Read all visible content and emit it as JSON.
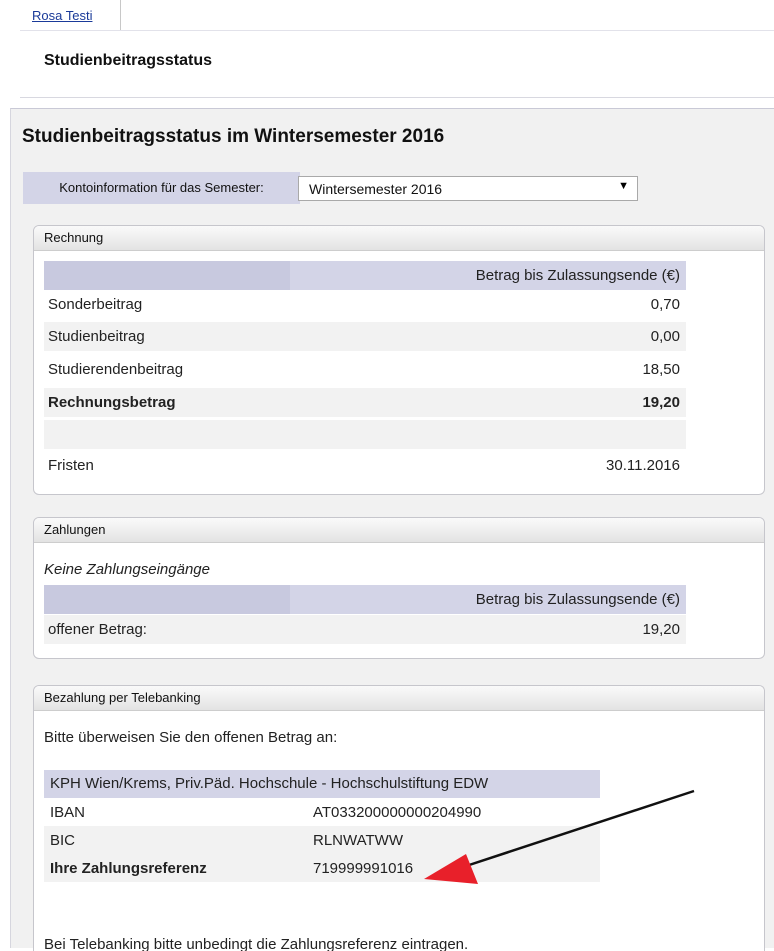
{
  "header": {
    "user_name": "Rosa Testi",
    "page_title": "Studienbeitragsstatus"
  },
  "main": {
    "title": "Studienbeitragsstatus im Wintersemester 2016",
    "semester_label": "Kontoinformation für das Semester:",
    "semester_value": "Wintersemester 2016"
  },
  "rechnung": {
    "title": "Rechnung",
    "column_header": "Betrag bis Zulassungsende (€)",
    "rows": [
      {
        "label": "Sonderbeitrag",
        "amount": "0,70"
      },
      {
        "label": "Studienbeitrag",
        "amount": "0,00"
      },
      {
        "label": "Studierendenbeitrag",
        "amount": "18,50"
      }
    ],
    "total_label": "Rechnungsbetrag",
    "total_amount": "19,20",
    "deadline_label": "Fristen",
    "deadline_value": "30.11.2016"
  },
  "zahlungen": {
    "title": "Zahlungen",
    "note": "Keine Zahlungseingänge",
    "column_header": "Betrag bis Zulassungsende (€)",
    "open_label": "offener Betrag:",
    "open_amount": "19,20"
  },
  "telebanking": {
    "title": "Bezahlung per Telebanking",
    "instruction": "Bitte überweisen Sie den offenen Betrag an:",
    "recipient": "KPH Wien/Krems, Priv.Päd. Hochschule - Hochschulstiftung EDW",
    "iban_label": "IBAN",
    "iban_value": "AT033200000000204990",
    "bic_label": "BIC",
    "bic_value": "RLNWATWW",
    "reference_label": "Ihre Zahlungsreferenz",
    "reference_value": "719999991016",
    "footnote": "Bei Telebanking bitte unbedingt die Zahlungsreferenz eintragen."
  },
  "colors": {
    "accent_header": "#d3d4e7",
    "annotation_arrow": "#e8202a"
  }
}
